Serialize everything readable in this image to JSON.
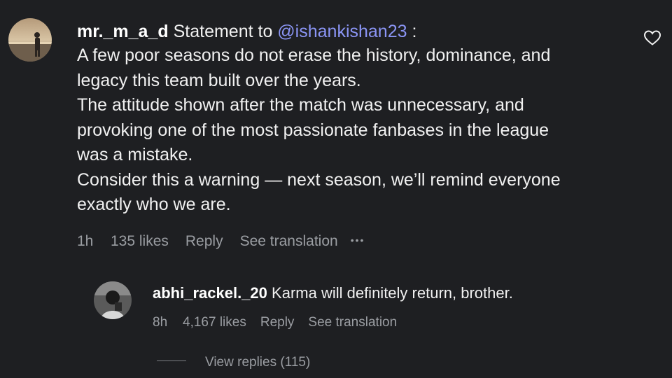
{
  "main_comment": {
    "username": "mr._m_a_d",
    "prefix": "Statement to",
    "mention": "@ishankishan23",
    "suffix": " :",
    "lines": [
      "A few poor seasons do not erase the history, dominance, and",
      "legacy this team built over the years.",
      "The attitude shown after the match was unnecessary, and",
      "provoking one of the most passionate fanbases in the league",
      "was a mistake.",
      "Consider this a warning — next season, we’ll remind everyone",
      "exactly who we are."
    ],
    "time": "1h",
    "likes": "135 likes",
    "reply_label": "Reply",
    "translation_label": "See translation",
    "more_label": "•••"
  },
  "reply": {
    "username": "abhi_rackel._20",
    "text": "Karma will definitely return, brother.",
    "time": "8h",
    "likes": "4,167 likes",
    "reply_label": "Reply",
    "translation_label": "See translation"
  },
  "view_replies": "View replies (115)",
  "icons": {
    "like": "heart-icon",
    "more": "more-options-icon"
  },
  "colors": {
    "background": "#1e1f22",
    "mention": "#8b95f5",
    "meta": "#9b9ea3"
  }
}
